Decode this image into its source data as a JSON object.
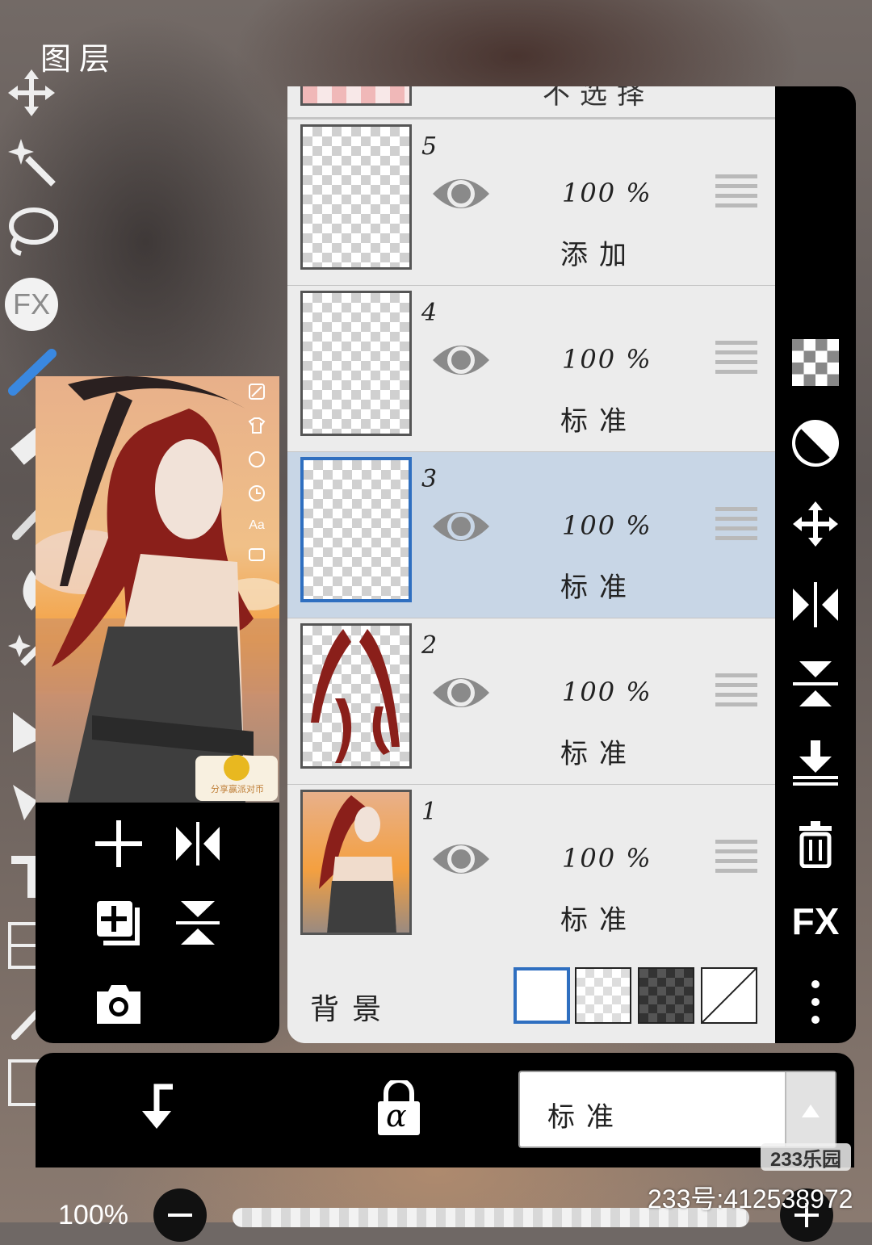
{
  "dialog": {
    "title": "图层"
  },
  "layers": [
    {
      "number": "5",
      "opacity": "100 %",
      "mode": "添加",
      "selected": false
    },
    {
      "number": "4",
      "opacity": "100 %",
      "mode": "标准",
      "selected": false
    },
    {
      "number": "3",
      "opacity": "100 %",
      "mode": "标准",
      "selected": true
    },
    {
      "number": "2",
      "opacity": "100 %",
      "mode": "标准",
      "selected": false
    },
    {
      "number": "1",
      "opacity": "100 %",
      "mode": "标准",
      "selected": false
    }
  ],
  "top_partial_label": "不选择",
  "background": {
    "label": "背景",
    "swatches": [
      "white",
      "checker-light",
      "checker-dark",
      "none"
    ],
    "selected": "white"
  },
  "preview": {
    "badge_text": "分享赢派对币",
    "side_icons": [
      "edit-icon",
      "shirt-icon",
      "palette-icon",
      "clock-icon",
      "text-size-icon",
      "gallery-icon"
    ],
    "side_text": "Aa"
  },
  "preview_actions": [
    "add-layer-icon",
    "flip-horizontal-icon",
    "duplicate-layer-icon",
    "flip-vertical-icon",
    "camera-icon"
  ],
  "right_toolbar": [
    "transparency-icon",
    "invert-icon",
    "move-icon",
    "flip-horizontal-icon",
    "flip-vertical-icon",
    "merge-down-icon",
    "delete-icon",
    "fx-icon",
    "more-icon"
  ],
  "right_toolbar_fx": "FX",
  "left_toolbar_fx": "FX",
  "bottom_bar": {
    "blend_mode": "标准",
    "alpha_lock": "α"
  },
  "zoom": {
    "level": "100%"
  },
  "watermark": {
    "logo": "233乐园",
    "id": "233号:412538972"
  },
  "colors": {
    "selected_row": "#c8d6e6",
    "accent": "#2f6fc0",
    "panel": "#e7e7e7",
    "toolbar": "#000000"
  }
}
